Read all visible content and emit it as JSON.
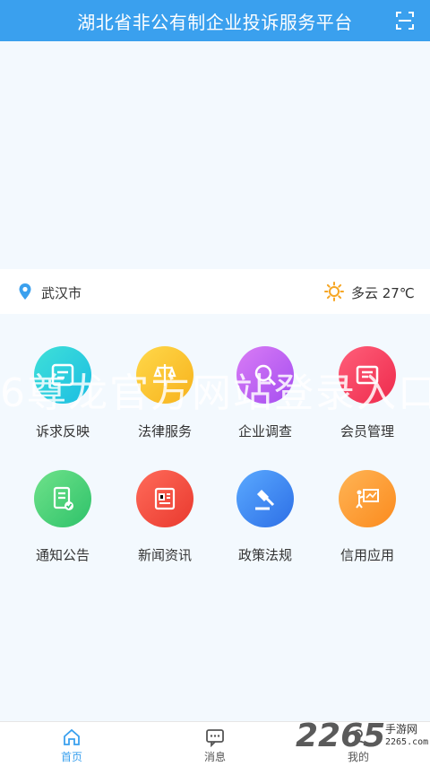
{
  "header": {
    "title": "湖北省非公有制企业投诉服务平台",
    "scan_icon": "scan-icon"
  },
  "location": {
    "city": "武汉市",
    "icon": "location-pin-icon"
  },
  "weather": {
    "text": "多云 27℃",
    "icon": "sun-icon"
  },
  "grid": [
    {
      "label": "诉求反映",
      "color_from": "#3fe0d8",
      "color_to": "#1bbde3"
    },
    {
      "label": "法律服务",
      "color_from": "#ffd84a",
      "color_to": "#f7b21c"
    },
    {
      "label": "企业调查",
      "color_from": "#d97cf5",
      "color_to": "#a54ef0"
    },
    {
      "label": "会员管理",
      "color_from": "#ff5f7a",
      "color_to": "#ee2a4c"
    },
    {
      "label": "通知公告",
      "color_from": "#6fe28a",
      "color_to": "#2ec26a"
    },
    {
      "label": "新闻资讯",
      "color_from": "#ff6b5a",
      "color_to": "#e9392e"
    },
    {
      "label": "政策法规",
      "color_from": "#5aa9ff",
      "color_to": "#2d6fe6"
    },
    {
      "label": "信用应用",
      "color_from": "#ffb455",
      "color_to": "#fb8b1e"
    }
  ],
  "watermark": "6尊龙官方网站登录入口",
  "tabs": [
    {
      "label": "首页",
      "active": true,
      "color": "#3aa0ee"
    },
    {
      "label": "消息",
      "active": false,
      "color": "#666666"
    },
    {
      "label": "我的",
      "active": false,
      "color": "#666666"
    }
  ],
  "brand": {
    "number": "2265",
    "sub": "手游网",
    "url": "2265.com"
  }
}
